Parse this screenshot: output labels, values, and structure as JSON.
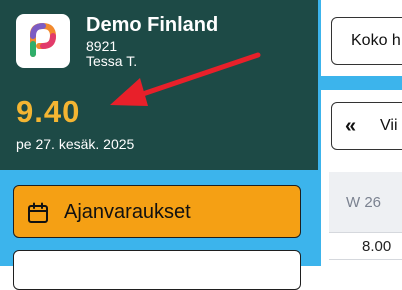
{
  "profile": {
    "org_name": "Demo Finland",
    "org_code": "8921",
    "user_name": "Tessa T.",
    "clock": "9.40",
    "date": "pe 27. kesäk. 2025"
  },
  "nav": {
    "appointments_label": "Ajanvaraukset"
  },
  "main": {
    "full_button_label": "Koko h",
    "prev_button_label": "Vii",
    "week_label": "W 26",
    "time_label": "8.00"
  },
  "colors": {
    "accent": "#f5a014",
    "profile_bg": "#1d4a46",
    "clock_color": "#f4b532",
    "sidebar_bg": "#3cb4ec",
    "arrow": "#e8202a"
  },
  "icons": {
    "logo": "app-logo-icon",
    "calendar": "calendar-icon",
    "chevrons": "double-chevron-left-icon",
    "arrow": "annotation-arrow-icon"
  }
}
